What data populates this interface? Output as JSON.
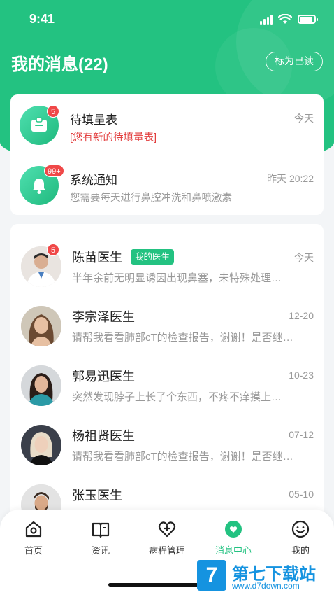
{
  "status_bar": {
    "time": "9:41"
  },
  "header": {
    "title": "我的消息(22)",
    "mark_read_label": "标为已读"
  },
  "system_messages": [
    {
      "title": "待填量表",
      "subtitle": "[您有新的待填量表]",
      "date": "今天",
      "badge": "5",
      "icon": "clipboard-icon"
    },
    {
      "title": "系统通知",
      "subtitle": "您需要每天进行鼻腔冲洗和鼻喷激素",
      "date": "昨天 20:22",
      "badge": "99+",
      "icon": "bell-icon"
    }
  ],
  "doctors": [
    {
      "name": "陈苗医生",
      "tag": "我的医生",
      "date": "今天",
      "message": "半年余前无明显诱因出现鼻塞，未特殊处理…",
      "badge": "5"
    },
    {
      "name": "李宗泽医生",
      "date": "12-20",
      "message": "请帮我看看肺部cT的检查报告，谢谢！是否继…"
    },
    {
      "name": "郭易迅医生",
      "date": "10-23",
      "message": "突然发现脖子上长了个东西，不疼不痒摸上…"
    },
    {
      "name": "杨祖贤医生",
      "date": "07-12",
      "message": "请帮我看看肺部cT的检查报告，谢谢！是否继…"
    },
    {
      "name": "张玉医生",
      "date": "05-10",
      "message": ""
    }
  ],
  "tabs": [
    {
      "label": "首页",
      "icon": "home-icon"
    },
    {
      "label": "资讯",
      "icon": "book-icon"
    },
    {
      "label": "病程管理",
      "icon": "heart-plus-icon"
    },
    {
      "label": "消息中心",
      "icon": "message-icon",
      "active": true
    },
    {
      "label": "我的",
      "icon": "smile-icon"
    }
  ],
  "watermark": {
    "brand": "第七下载站",
    "url": "www.d7down.com",
    "logo_letter": "7"
  },
  "colors": {
    "primary": "#23c281",
    "badge": "#f04848",
    "alert_text": "#e23e3e"
  }
}
